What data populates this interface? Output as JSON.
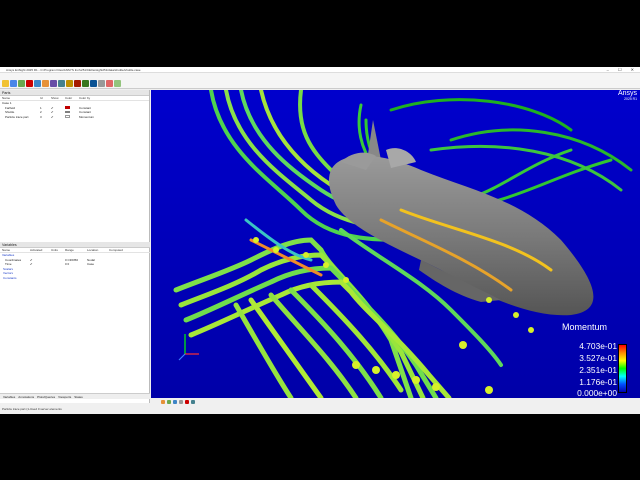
{
  "window": {
    "title": "Ansys EnSight 2025 R1 - C:/Program Files/ANSYS Inc/v251/CEI/ensight251/data/shuttle/shuttle.case",
    "controls": "– ☐ ✕"
  },
  "menu": [
    "File",
    "Edit",
    "Create",
    "Query",
    "View",
    "Tools",
    "Window",
    "Case",
    "Reports",
    "Help"
  ],
  "parts_panel": {
    "title": "Parts",
    "columns": [
      "Name",
      "Id",
      "Show",
      "Color",
      "Color by"
    ],
    "items": [
      {
        "name": "Case 1",
        "id": "",
        "show": "",
        "color": "",
        "colorby": ""
      },
      {
        "name": "Farfield",
        "id": "1",
        "show": "✔",
        "color": "#c00000",
        "colorby": "Constant"
      },
      {
        "name": "Shuttle",
        "id": "2",
        "show": "✔",
        "color": "#7f7f7f",
        "colorby": "Constant"
      },
      {
        "name": "Particle trace part",
        "id": "3",
        "show": "✔",
        "color": "#ffffff",
        "colorby": "Momentum"
      }
    ]
  },
  "variables_panel": {
    "title": "Variables",
    "columns": [
      "Name",
      "Activated",
      "Units",
      "Range",
      "Location",
      "Computed"
    ],
    "items": [
      {
        "name": "Variables",
        "activated": "",
        "units": "",
        "range": "",
        "location": "",
        "computed": "",
        "link": true
      },
      {
        "name": "Coordinates",
        "activated": "✔",
        "units": "",
        "range": "0    C36350",
        "location": "Nodal",
        "computed": ""
      },
      {
        "name": "Time",
        "activated": "✔",
        "units": "",
        "range": "0    0",
        "location": "Case",
        "computed": ""
      },
      {
        "name": "Scalars",
        "activated": "",
        "units": "",
        "range": "",
        "location": "",
        "computed": "",
        "link": true
      },
      {
        "name": "Vectors",
        "activated": "",
        "units": "",
        "range": "",
        "location": "",
        "computed": "",
        "link": true
      },
      {
        "name": "Constants",
        "activated": "",
        "units": "",
        "range": "",
        "location": "",
        "computed": "",
        "link": true
      }
    ]
  },
  "bottom_tabs": [
    "Variables",
    "Annotations",
    "Plots/Queries",
    "Viewports",
    "States"
  ],
  "status": "Particle trace part (1-Used 0 server elements",
  "viewport": {
    "brand": "Ansys",
    "version": "2025 R1",
    "legend": {
      "title": "Momentum",
      "labels": [
        "4.703e-01",
        "3.527e-01",
        "2.351e-01",
        "1.176e-01",
        "0.000e+00"
      ]
    },
    "axes": {
      "x": "X",
      "y": "Y",
      "z": "Z"
    }
  }
}
